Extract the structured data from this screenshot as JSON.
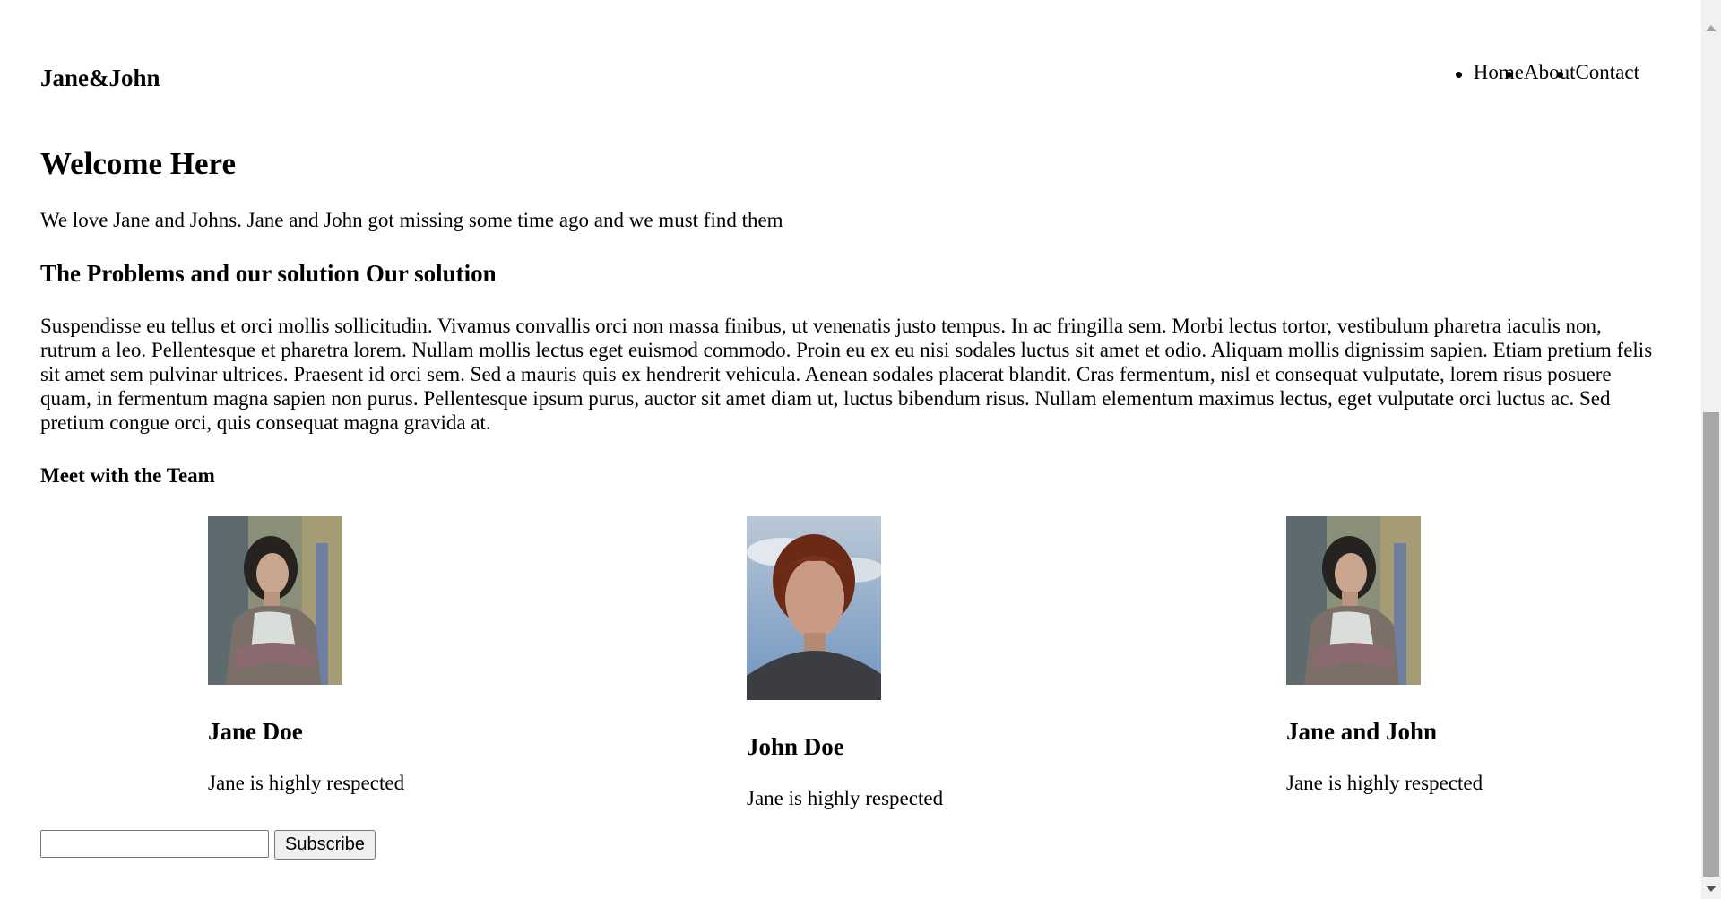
{
  "header": {
    "brand": "Jane&John",
    "nav": [
      "Home",
      "About",
      "Contact"
    ]
  },
  "main": {
    "title": "Welcome Here",
    "intro": "We love Jane and Johns. Jane and John got missing some time ago and we must find them",
    "problems_heading": "The Problems and our solution Our solution",
    "body": "Suspendisse eu tellus et orci mollis sollicitudin. Vivamus convallis orci non massa finibus, ut venenatis justo tempus. In ac fringilla sem. Morbi lectus tortor, vestibulum pharetra iaculis non, rutrum a leo. Pellentesque et pharetra lorem. Nullam mollis lectus eget euismod commodo. Proin eu ex eu nisi sodales luctus sit amet et odio. Aliquam mollis dignissim sapien. Etiam pretium felis sit amet sem pulvinar ultrices. Praesent id orci sem. Sed a mauris quis ex hendrerit vehicula. Aenean sodales placerat blandit. Cras fermentum, nisl et consequat vulputate, lorem risus posuere quam, in fermentum magna sapien non purus. Pellentesque ipsum purus, auctor sit amet diam ut, luctus bibendum risus. Nullam elementum maximus lectus, eget vulputate orci luctus ac. Sed pretium congue orci, quis consequat magna gravida at."
  },
  "team": {
    "heading": "Meet with the Team",
    "members": [
      {
        "name": "Jane Doe",
        "desc": "Jane is highly respected"
      },
      {
        "name": "John Doe",
        "desc": "Jane is highly respected"
      },
      {
        "name": "Jane and John",
        "desc": "Jane is highly respected"
      }
    ]
  },
  "subscribe": {
    "input_value": "",
    "button_label": "Subscribe"
  }
}
